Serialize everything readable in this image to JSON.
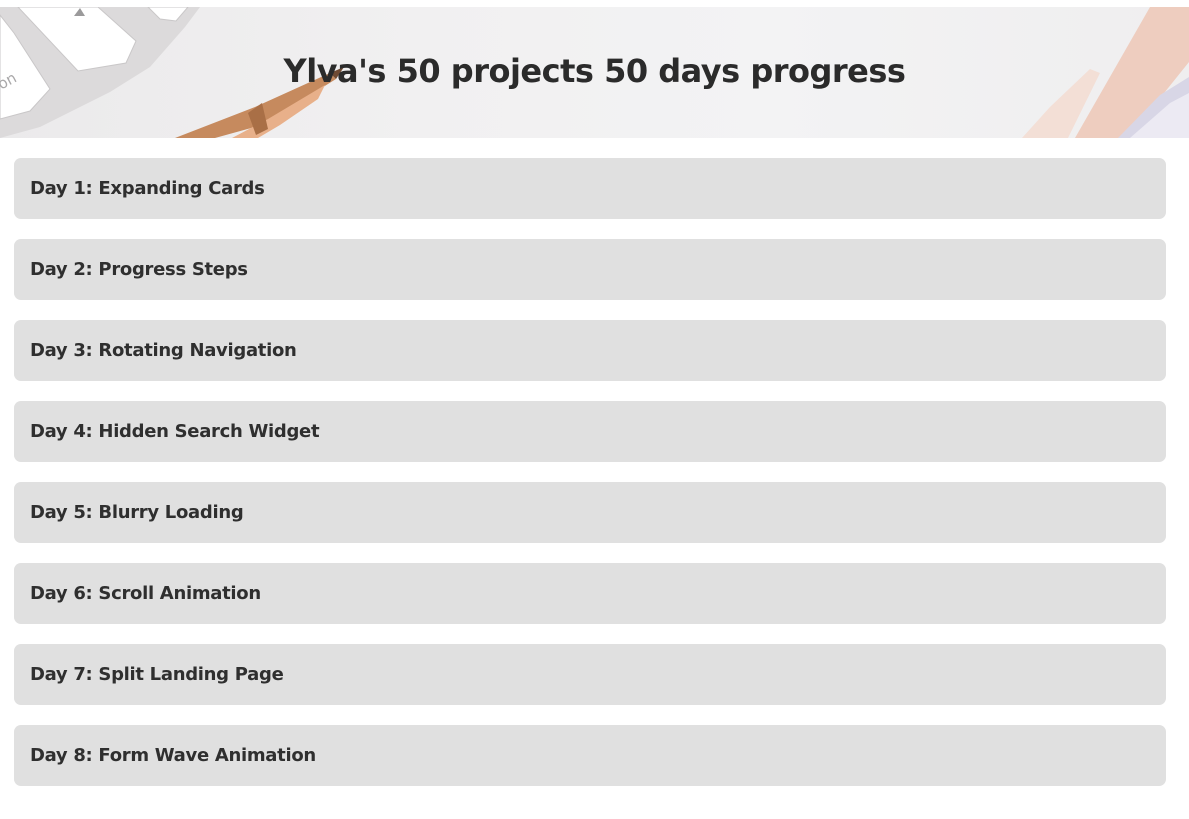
{
  "header": {
    "title": "Ylva's 50 projects 50 days progress",
    "background_description_icon": "desk-photo"
  },
  "projects": [
    {
      "label": "Day 1: Expanding Cards"
    },
    {
      "label": "Day 2: Progress Steps"
    },
    {
      "label": "Day 3: Rotating Navigation"
    },
    {
      "label": "Day 4: Hidden Search Widget"
    },
    {
      "label": "Day 5: Blurry Loading"
    },
    {
      "label": "Day 6: Scroll Animation"
    },
    {
      "label": "Day 7: Split Landing Page"
    },
    {
      "label": "Day 8: Form Wave Animation"
    }
  ],
  "colors": {
    "card_background": "#e0e0e0",
    "text": "#2f2f2f",
    "page_background": "#ffffff"
  }
}
